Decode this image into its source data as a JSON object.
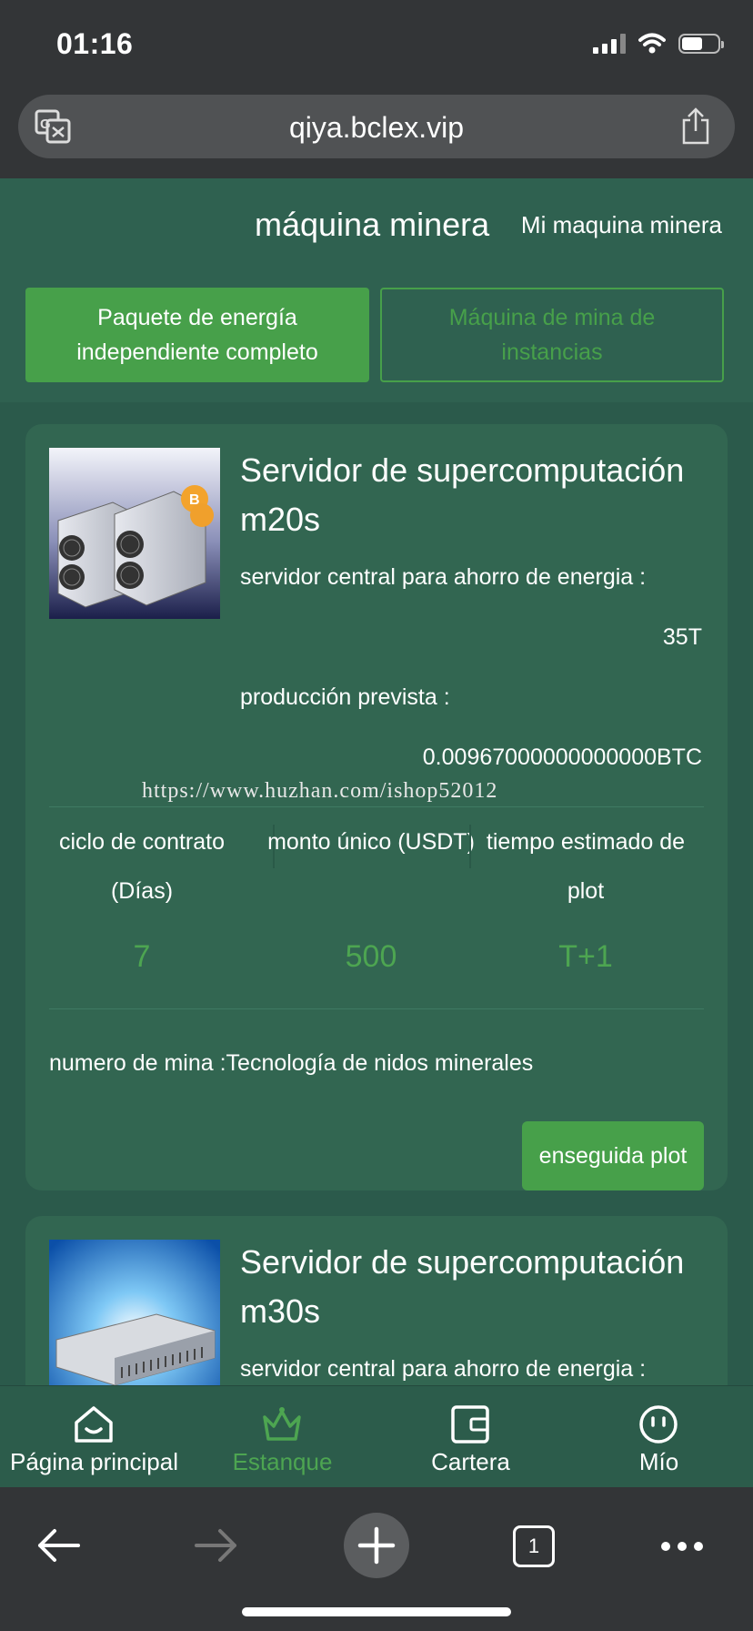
{
  "status_bar": {
    "time": "01:16"
  },
  "browser": {
    "url": "qiya.bclex.vip"
  },
  "header": {
    "title": "máquina minera",
    "my_miners_link": "Mi maquina minera",
    "tabs": [
      {
        "label": "Paquete de energía independiente completo",
        "active": true
      },
      {
        "label": "Máquina de mina de instancias",
        "active": false
      }
    ]
  },
  "products": [
    {
      "name": "Servidor de supercomputación m20s",
      "power_saving_label": "servidor central para ahorro de energia :",
      "power_saving_value": "35T",
      "expected_output_label": "producción prevista :",
      "expected_output_value": "0.00967000000000000BTC",
      "contract_cycle_label": "ciclo de contrato (Días)",
      "contract_cycle_value": "7",
      "single_amount_label": "monto único (USDT)",
      "single_amount_value": "500",
      "estimated_time_label": "tiempo estimado de plot",
      "estimated_time_value": "T+1",
      "mine_number": "numero de mina :Tecnología de nidos minerales",
      "buy_button": "enseguida plot"
    },
    {
      "name": "Servidor de supercomputación m30s",
      "power_saving_label": "servidor central para ahorro de energia :"
    }
  ],
  "watermark": "https://www.huzhan.com/ishop52012",
  "bottom_nav": [
    {
      "label": "Página principal",
      "icon": "home-icon",
      "active": false
    },
    {
      "label": "Estanque",
      "icon": "crown-icon",
      "active": true
    },
    {
      "label": "Cartera",
      "icon": "wallet-icon",
      "active": false
    },
    {
      "label": "Mío",
      "icon": "smiley-icon",
      "active": false
    }
  ],
  "browser_toolbar": {
    "tab_count": "1"
  },
  "colors": {
    "accent": "#47a04a",
    "background": "#2f6150",
    "card": "#326651",
    "browser_chrome": "#333537"
  }
}
